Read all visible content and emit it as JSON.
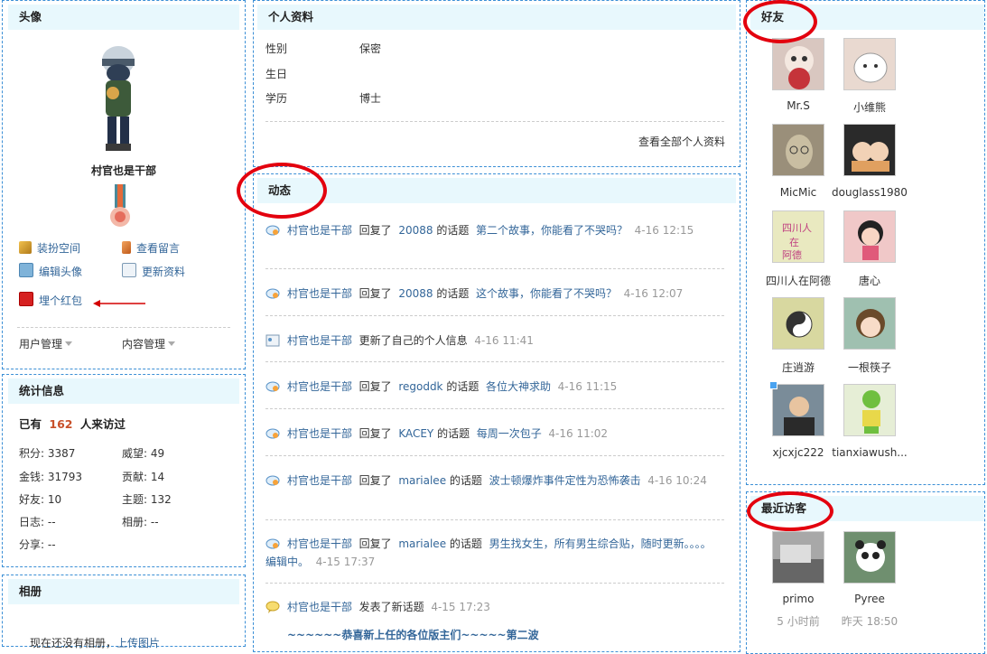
{
  "left": {
    "avatar_title": "头像",
    "username": "村官也是干部",
    "actions": [
      {
        "label": "装扮空间",
        "icon": "key-icon"
      },
      {
        "label": "查看留言",
        "icon": "pencil-icon"
      },
      {
        "label": "编辑头像",
        "icon": "edit-avatar-icon"
      },
      {
        "label": "更新资料",
        "icon": "profile-card-icon"
      },
      {
        "label": "埋个红包",
        "icon": "red-envelope-icon"
      }
    ],
    "menu": {
      "user_mgmt": "用户管理",
      "content_mgmt": "内容管理"
    },
    "stats_title": "统计信息",
    "visitors_prefix": "已有",
    "visitors_count": "162",
    "visitors_suffix": "人来访过",
    "stats": [
      {
        "label": "积分: 3387"
      },
      {
        "label": "威望: 49"
      },
      {
        "label": "金钱: 31793"
      },
      {
        "label": "贡献: 14"
      },
      {
        "label": "好友: 10"
      },
      {
        "label": "主题: 132"
      },
      {
        "label": "日志: --"
      },
      {
        "label": "相册: --"
      },
      {
        "label": "分享: --"
      }
    ],
    "album_title": "相册",
    "album_text": "现在还没有相册，",
    "album_link": "上传图片"
  },
  "profile": {
    "title": "个人资料",
    "rows": [
      {
        "key": "性别",
        "value": "保密"
      },
      {
        "key": "生日",
        "value": ""
      },
      {
        "key": "学历",
        "value": "博士"
      }
    ],
    "view_all": "查看全部个人资料"
  },
  "feed": {
    "title": "动态",
    "items": [
      {
        "user": "村官也是干部",
        "action": "回复了",
        "target": "20088",
        "mid": "的话题",
        "topic": "第二个故事，你能看了不哭吗？",
        "time": "4-16 12:15",
        "icon": "reply-icon"
      },
      {
        "user": "村官也是干部",
        "action": "回复了",
        "target": "20088",
        "mid": "的话题",
        "topic": "这个故事，你能看了不哭吗？",
        "time": "4-16 12:07",
        "icon": "reply-icon"
      },
      {
        "user": "村官也是干部",
        "action": "更新了自己的个人信息",
        "target": "",
        "mid": "",
        "topic": "",
        "time": "4-16 11:41",
        "icon": "profile-update-icon"
      },
      {
        "user": "村官也是干部",
        "action": "回复了",
        "target": "regoddk",
        "mid": "的话题",
        "topic": "各位大神求助",
        "time": "4-16 11:15",
        "icon": "reply-icon"
      },
      {
        "user": "村官也是干部",
        "action": "回复了",
        "target": "KACEY",
        "mid": "的话题",
        "topic": "每周一次包子",
        "time": "4-16 11:02",
        "icon": "reply-icon"
      },
      {
        "user": "村官也是干部",
        "action": "回复了",
        "target": "marialee",
        "mid": "的话题",
        "topic": "波士顿爆炸事件定性为恐怖袭击",
        "time": "4-16 10:24",
        "icon": "reply-icon"
      },
      {
        "user": "村官也是干部",
        "action": "回复了",
        "target": "marialee",
        "mid": "的话题",
        "topic": "男生找女生，所有男生综合贴，随时更新。。。。编辑中。",
        "time": "4-15 17:37",
        "icon": "reply-icon"
      },
      {
        "user": "村官也是干部",
        "action": "发表了新话题",
        "target": "",
        "mid": "",
        "topic": "",
        "time": "4-15 17:23",
        "icon": "new-topic-icon"
      }
    ],
    "last_topic": "~~~~~~恭喜新上任的各位版主们~~~~~第二波"
  },
  "friends": {
    "title": "好友",
    "list": [
      {
        "name": "Mr.S",
        "color": "#d9c7c0"
      },
      {
        "name": "小维熊",
        "color": "#e9d9d0"
      },
      {
        "name": "MicMic",
        "color": "#9a8f7a"
      },
      {
        "name": "douglass1980",
        "color": "#c4956c"
      },
      {
        "name": "四川人在阿德",
        "color": "#e9e9c0"
      },
      {
        "name": "唐心",
        "color": "#f0c8c8"
      },
      {
        "name": "庄逍游",
        "color": "#d8d8a0"
      },
      {
        "name": "一根筷子",
        "color": "#9fc0b0"
      },
      {
        "name": "xjcxjc222",
        "color": "#7a8c99"
      },
      {
        "name": "tianxiawush...",
        "color": "#e6eed6"
      }
    ]
  },
  "visitors": {
    "title": "最近访客",
    "list": [
      {
        "name": "primo",
        "time": "5 小时前",
        "color": "#a8a8a8"
      },
      {
        "name": "Pyree",
        "time": "昨天 18:50",
        "color": "#6f8f6f"
      }
    ]
  }
}
